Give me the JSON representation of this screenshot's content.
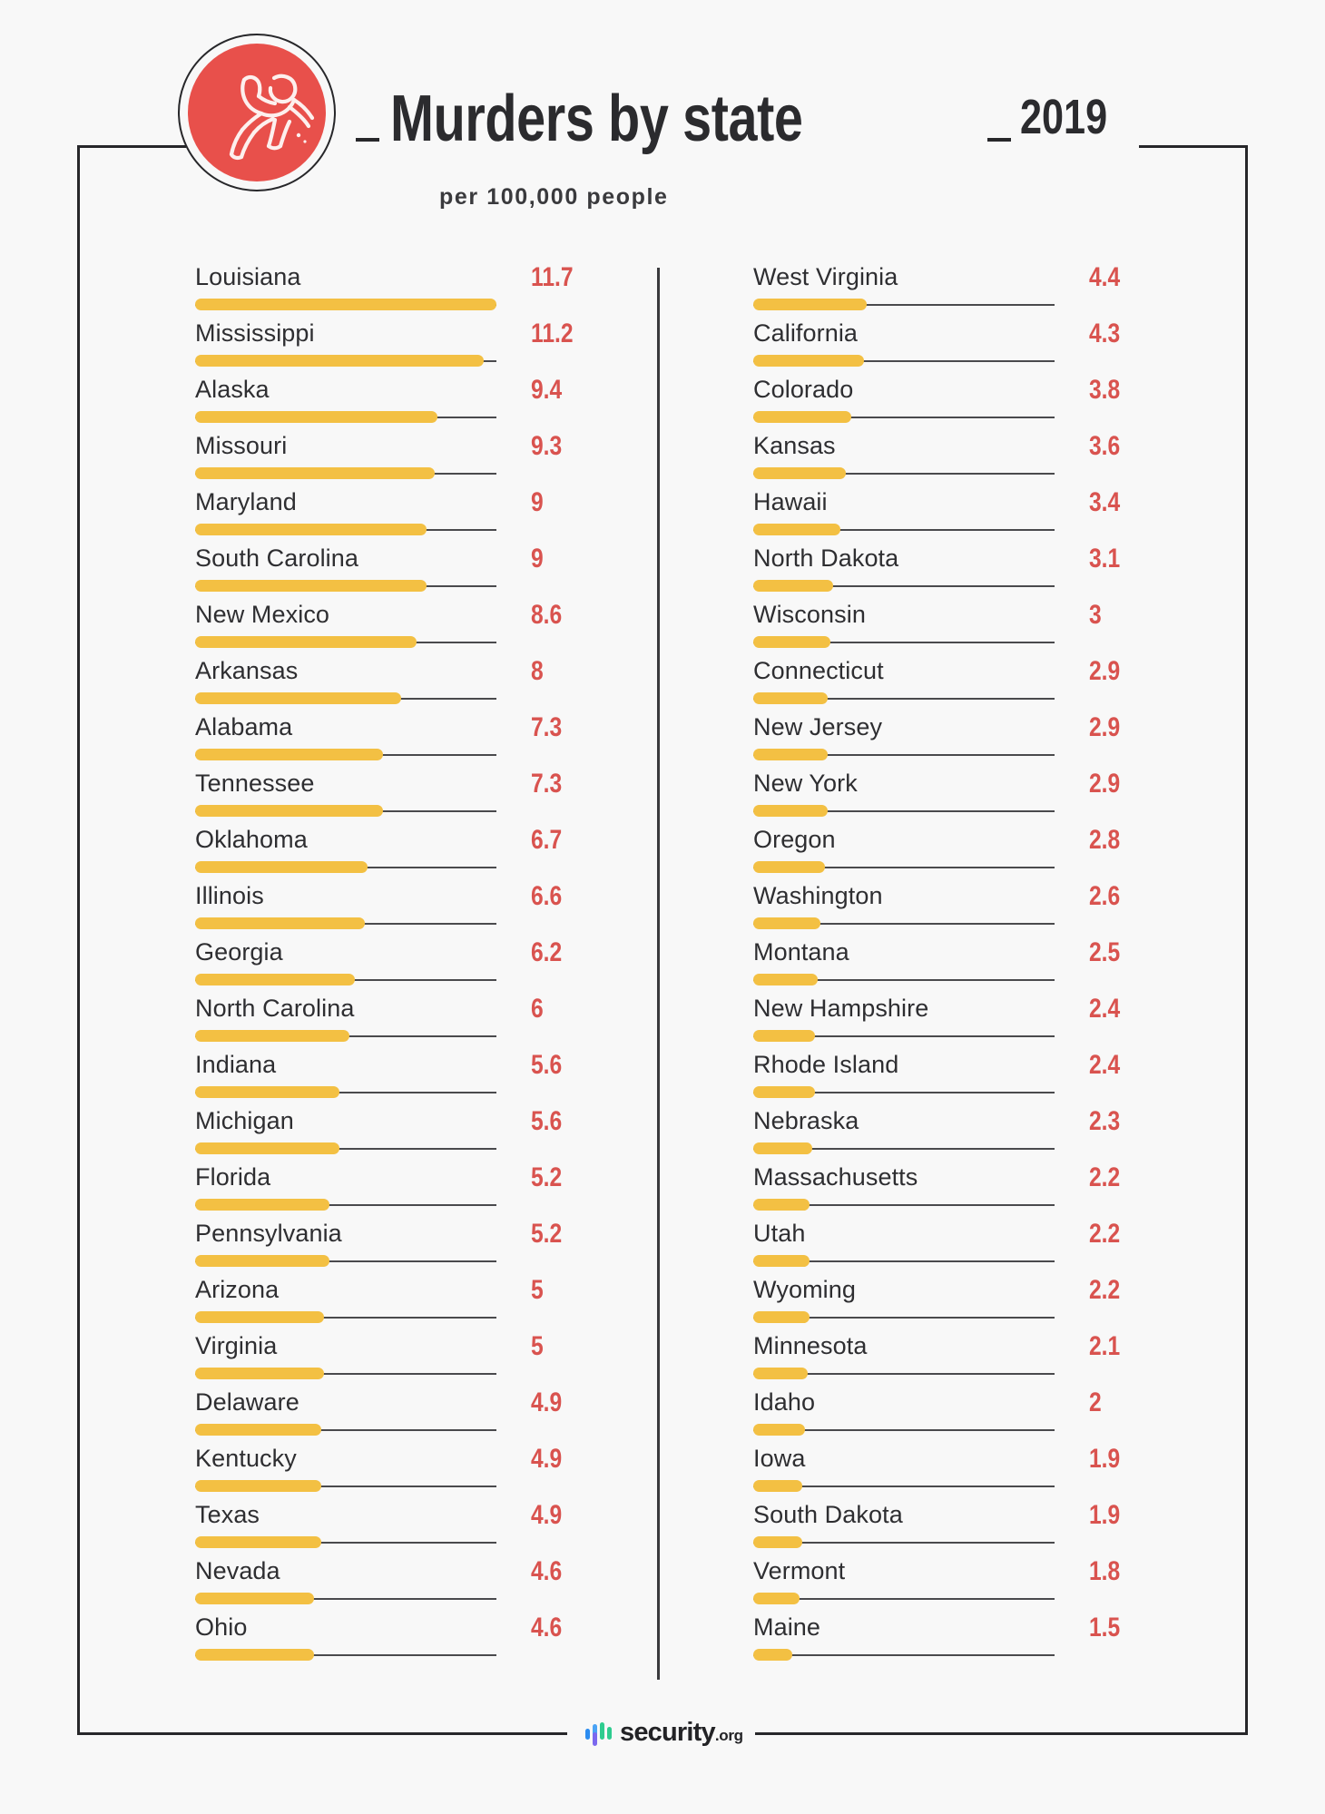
{
  "header": {
    "title": "Murders by state",
    "year": "2019",
    "subtitle": "per 100,000 people",
    "badge_icon": "chalk-outline-body-icon",
    "badge_color": "#e8504b"
  },
  "footer": {
    "brand": "security",
    "tld": ".org",
    "logo_icon": "security-org-bars-icon",
    "logo_colors": [
      "#2b8cf0",
      "#7b68ee",
      "#2ecc8f"
    ]
  },
  "colors": {
    "bar": "#f3c043",
    "value": "#d9534f",
    "track": "#4a4a4d",
    "text": "#2e2e31",
    "frame": "#27272a",
    "background": "#f8f8f8"
  },
  "chart_data": {
    "type": "bar",
    "title": "Murders by state – 2019",
    "subtitle": "per 100,000 people",
    "xlabel": "",
    "ylabel": "Murders per 100,000 people",
    "orientation": "horizontal",
    "value_max": 11.7,
    "categories": [
      "Louisiana",
      "Mississippi",
      "Alaska",
      "Missouri",
      "Maryland",
      "South Carolina",
      "New Mexico",
      "Arkansas",
      "Alabama",
      "Tennessee",
      "Oklahoma",
      "Illinois",
      "Georgia",
      "North Carolina",
      "Indiana",
      "Michigan",
      "Florida",
      "Pennsylvania",
      "Arizona",
      "Virginia",
      "Delaware",
      "Kentucky",
      "Texas",
      "Nevada",
      "Ohio",
      "West Virginia",
      "California",
      "Colorado",
      "Kansas",
      "Hawaii",
      "North Dakota",
      "Wisconsin",
      "Connecticut",
      "New Jersey",
      "New York",
      "Oregon",
      "Washington",
      "Montana",
      "New Hampshire",
      "Rhode Island",
      "Nebraska",
      "Massachusetts",
      "Utah",
      "Wyoming",
      "Minnesota",
      "Idaho",
      "Iowa",
      "South Dakota",
      "Vermont",
      "Maine"
    ],
    "values": [
      11.7,
      11.2,
      9.4,
      9.3,
      9,
      9,
      8.6,
      8,
      7.3,
      7.3,
      6.7,
      6.6,
      6.2,
      6,
      5.6,
      5.6,
      5.2,
      5.2,
      5,
      5,
      4.9,
      4.9,
      4.9,
      4.6,
      4.6,
      4.4,
      4.3,
      3.8,
      3.6,
      3.4,
      3.1,
      3,
      2.9,
      2.9,
      2.9,
      2.8,
      2.6,
      2.5,
      2.4,
      2.4,
      2.3,
      2.2,
      2.2,
      2.2,
      2.1,
      2,
      1.9,
      1.9,
      1.8,
      1.5
    ]
  },
  "columns": {
    "left": [
      {
        "state": "Louisiana",
        "value": "11.7",
        "num": 11.7
      },
      {
        "state": "Mississippi",
        "value": "11.2",
        "num": 11.2
      },
      {
        "state": "Alaska",
        "value": "9.4",
        "num": 9.4
      },
      {
        "state": "Missouri",
        "value": "9.3",
        "num": 9.3
      },
      {
        "state": "Maryland",
        "value": "9",
        "num": 9
      },
      {
        "state": "South Carolina",
        "value": "9",
        "num": 9
      },
      {
        "state": "New Mexico",
        "value": "8.6",
        "num": 8.6
      },
      {
        "state": "Arkansas",
        "value": "8",
        "num": 8
      },
      {
        "state": "Alabama",
        "value": "7.3",
        "num": 7.3
      },
      {
        "state": "Tennessee",
        "value": "7.3",
        "num": 7.3
      },
      {
        "state": "Oklahoma",
        "value": "6.7",
        "num": 6.7
      },
      {
        "state": "Illinois",
        "value": "6.6",
        "num": 6.6
      },
      {
        "state": "Georgia",
        "value": "6.2",
        "num": 6.2
      },
      {
        "state": "North Carolina",
        "value": "6",
        "num": 6
      },
      {
        "state": "Indiana",
        "value": "5.6",
        "num": 5.6
      },
      {
        "state": "Michigan",
        "value": "5.6",
        "num": 5.6
      },
      {
        "state": "Florida",
        "value": "5.2",
        "num": 5.2
      },
      {
        "state": "Pennsylvania",
        "value": "5.2",
        "num": 5.2
      },
      {
        "state": "Arizona",
        "value": "5",
        "num": 5
      },
      {
        "state": "Virginia",
        "value": "5",
        "num": 5
      },
      {
        "state": "Delaware",
        "value": "4.9",
        "num": 4.9
      },
      {
        "state": "Kentucky",
        "value": "4.9",
        "num": 4.9
      },
      {
        "state": "Texas",
        "value": "4.9",
        "num": 4.9
      },
      {
        "state": "Nevada",
        "value": "4.6",
        "num": 4.6
      },
      {
        "state": "Ohio",
        "value": "4.6",
        "num": 4.6
      }
    ],
    "right": [
      {
        "state": "West Virginia",
        "value": "4.4",
        "num": 4.4
      },
      {
        "state": "California",
        "value": "4.3",
        "num": 4.3
      },
      {
        "state": "Colorado",
        "value": "3.8",
        "num": 3.8
      },
      {
        "state": "Kansas",
        "value": "3.6",
        "num": 3.6
      },
      {
        "state": "Hawaii",
        "value": "3.4",
        "num": 3.4
      },
      {
        "state": "North Dakota",
        "value": "3.1",
        "num": 3.1
      },
      {
        "state": "Wisconsin",
        "value": "3",
        "num": 3
      },
      {
        "state": "Connecticut",
        "value": "2.9",
        "num": 2.9
      },
      {
        "state": "New Jersey",
        "value": "2.9",
        "num": 2.9
      },
      {
        "state": "New York",
        "value": "2.9",
        "num": 2.9
      },
      {
        "state": "Oregon",
        "value": "2.8",
        "num": 2.8
      },
      {
        "state": "Washington",
        "value": "2.6",
        "num": 2.6
      },
      {
        "state": "Montana",
        "value": "2.5",
        "num": 2.5
      },
      {
        "state": "New Hampshire",
        "value": "2.4",
        "num": 2.4
      },
      {
        "state": "Rhode Island",
        "value": "2.4",
        "num": 2.4
      },
      {
        "state": "Nebraska",
        "value": "2.3",
        "num": 2.3
      },
      {
        "state": "Massachusetts",
        "value": "2.2",
        "num": 2.2
      },
      {
        "state": "Utah",
        "value": "2.2",
        "num": 2.2
      },
      {
        "state": "Wyoming",
        "value": "2.2",
        "num": 2.2
      },
      {
        "state": "Minnesota",
        "value": "2.1",
        "num": 2.1
      },
      {
        "state": "Idaho",
        "value": "2",
        "num": 2
      },
      {
        "state": "Iowa",
        "value": "1.9",
        "num": 1.9
      },
      {
        "state": "South Dakota",
        "value": "1.9",
        "num": 1.9
      },
      {
        "state": "Vermont",
        "value": "1.8",
        "num": 1.8
      },
      {
        "state": "Maine",
        "value": "1.5",
        "num": 1.5
      }
    ]
  }
}
